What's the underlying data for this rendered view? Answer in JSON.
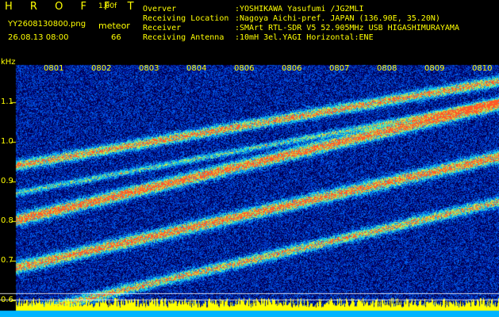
{
  "header": {
    "brand": "H R O F F T",
    "version": "1.00f",
    "filename": "YY2608130800.png",
    "label_meteor": "meteor",
    "datetime": "26.08.13 08:00",
    "count": "66",
    "info": [
      {
        "key": "Overver",
        "value": ":YOSHIKAWA Yasufumi /JG2MLI"
      },
      {
        "key": "Receiving Location",
        "value": ":Nagoya Aichi-pref. JAPAN (136.90E, 35.20N)"
      },
      {
        "key": "Receiver",
        "value": ":SMArt RTL-SDR V5 52.905MHz USB HIGASHIMURAYAMA"
      },
      {
        "key": "Receiving Antenna",
        "value": ":10mH 3el.YAGI Horizontal:ENE"
      }
    ]
  },
  "chart_data": {
    "type": "heatmap",
    "ylabel": "kHz",
    "y_ticks": [
      "1.1",
      "1.0",
      "0.9",
      "0.8",
      "0.7",
      "0.6"
    ],
    "x_ticks": [
      "0801",
      "0802",
      "0803",
      "0804",
      "0806",
      "0806",
      "0807",
      "0808",
      "0809",
      "0810"
    ]
  },
  "colors": {
    "background": "#000000",
    "text": "#ffff00",
    "noise_low": "#000066",
    "noise_mid": "#1a3cff",
    "trace": "#32d2ff",
    "trace_hot": "#ffe040",
    "baseline_bar": "#ffff00",
    "baseline_floor": "#00b4ff"
  }
}
